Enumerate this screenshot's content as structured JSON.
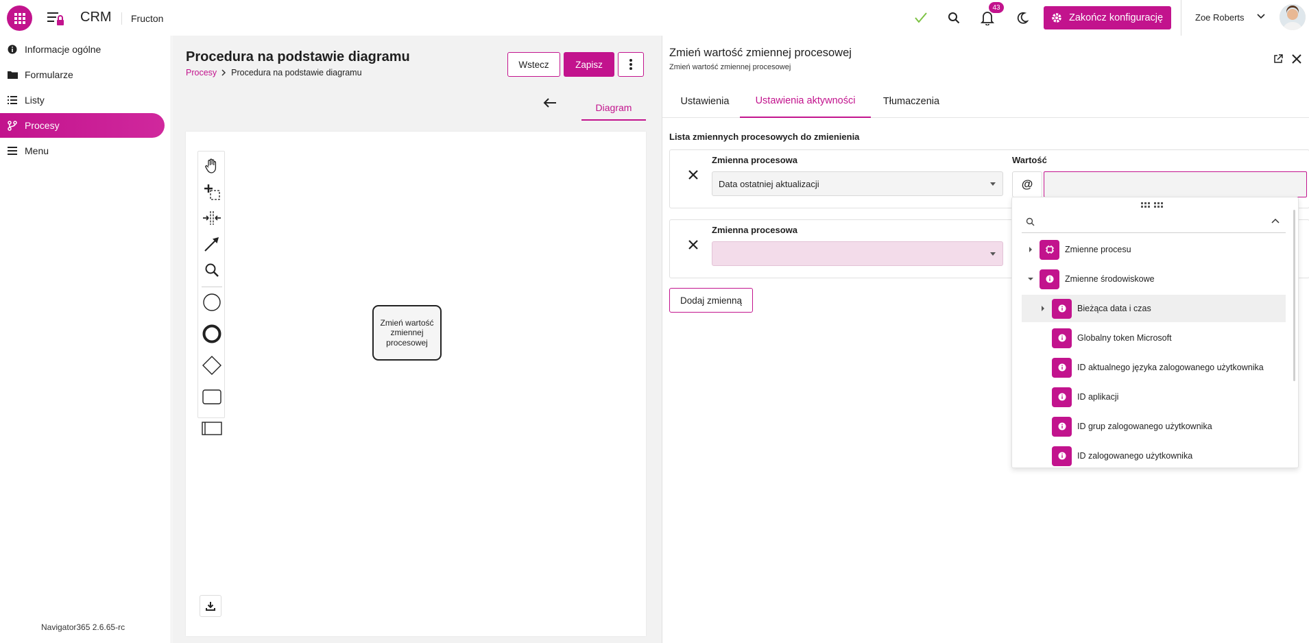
{
  "topbar": {
    "brand": "CRM",
    "company": "Fructon",
    "notification_count": "43",
    "finish_button": "Zakończ konfigurację",
    "user_name": "Zoe Roberts",
    "accent": "#c2138d"
  },
  "sidebar": {
    "items": [
      {
        "label": "Informacje ogólne",
        "icon": "info-icon"
      },
      {
        "label": "Formularze",
        "icon": "folder-icon"
      },
      {
        "label": "Listy",
        "icon": "list-icon"
      },
      {
        "label": "Procesy",
        "icon": "branch-icon",
        "active": true
      },
      {
        "label": "Menu",
        "icon": "menu-icon"
      }
    ],
    "version": "Navigator365 2.6.65-rc"
  },
  "middle": {
    "title": "Procedura na podstawie diagramu",
    "breadcrumb": {
      "link": "Procesy",
      "current": "Procedura na podstawie diagramu"
    },
    "back_button": "Wstecz",
    "save_button": "Zapisz",
    "diagram_tab": "Diagram",
    "task_label": "Zmień wartość zmiennej procesowej"
  },
  "panel": {
    "title": "Zmień wartość zmiennej procesowej",
    "subtitle": "Zmień wartość zmiennej procesowej",
    "tabs": [
      "Ustawienia",
      "Ustawienia aktywności",
      "Tłumaczenia"
    ],
    "active_tab": "Ustawienia aktywności",
    "section_title": "Lista zmiennych procesowych do zmienienia",
    "field_label": "Zmienna procesowa",
    "value_label": "Wartość",
    "row1_value": "Data ostatniej aktualizacji",
    "row2_value": "",
    "at_symbol": "@",
    "add_button": "Dodaj zmienną"
  },
  "dropdown": {
    "search_placeholder": "",
    "groups": [
      {
        "label": "Zmienne procesu",
        "expanded": false
      },
      {
        "label": "Zmienne środowiskowe",
        "expanded": true
      }
    ],
    "items": [
      {
        "label": "Bieżąca data i czas",
        "has_children": true,
        "highlighted": true
      },
      {
        "label": "Globalny token Microsoft"
      },
      {
        "label": "ID aktualnego języka zalogowanego użytkownika"
      },
      {
        "label": "ID aplikacji"
      },
      {
        "label": "ID grup zalogowanego użytkownika"
      },
      {
        "label": "ID zalogowanego użytkownika"
      }
    ]
  }
}
